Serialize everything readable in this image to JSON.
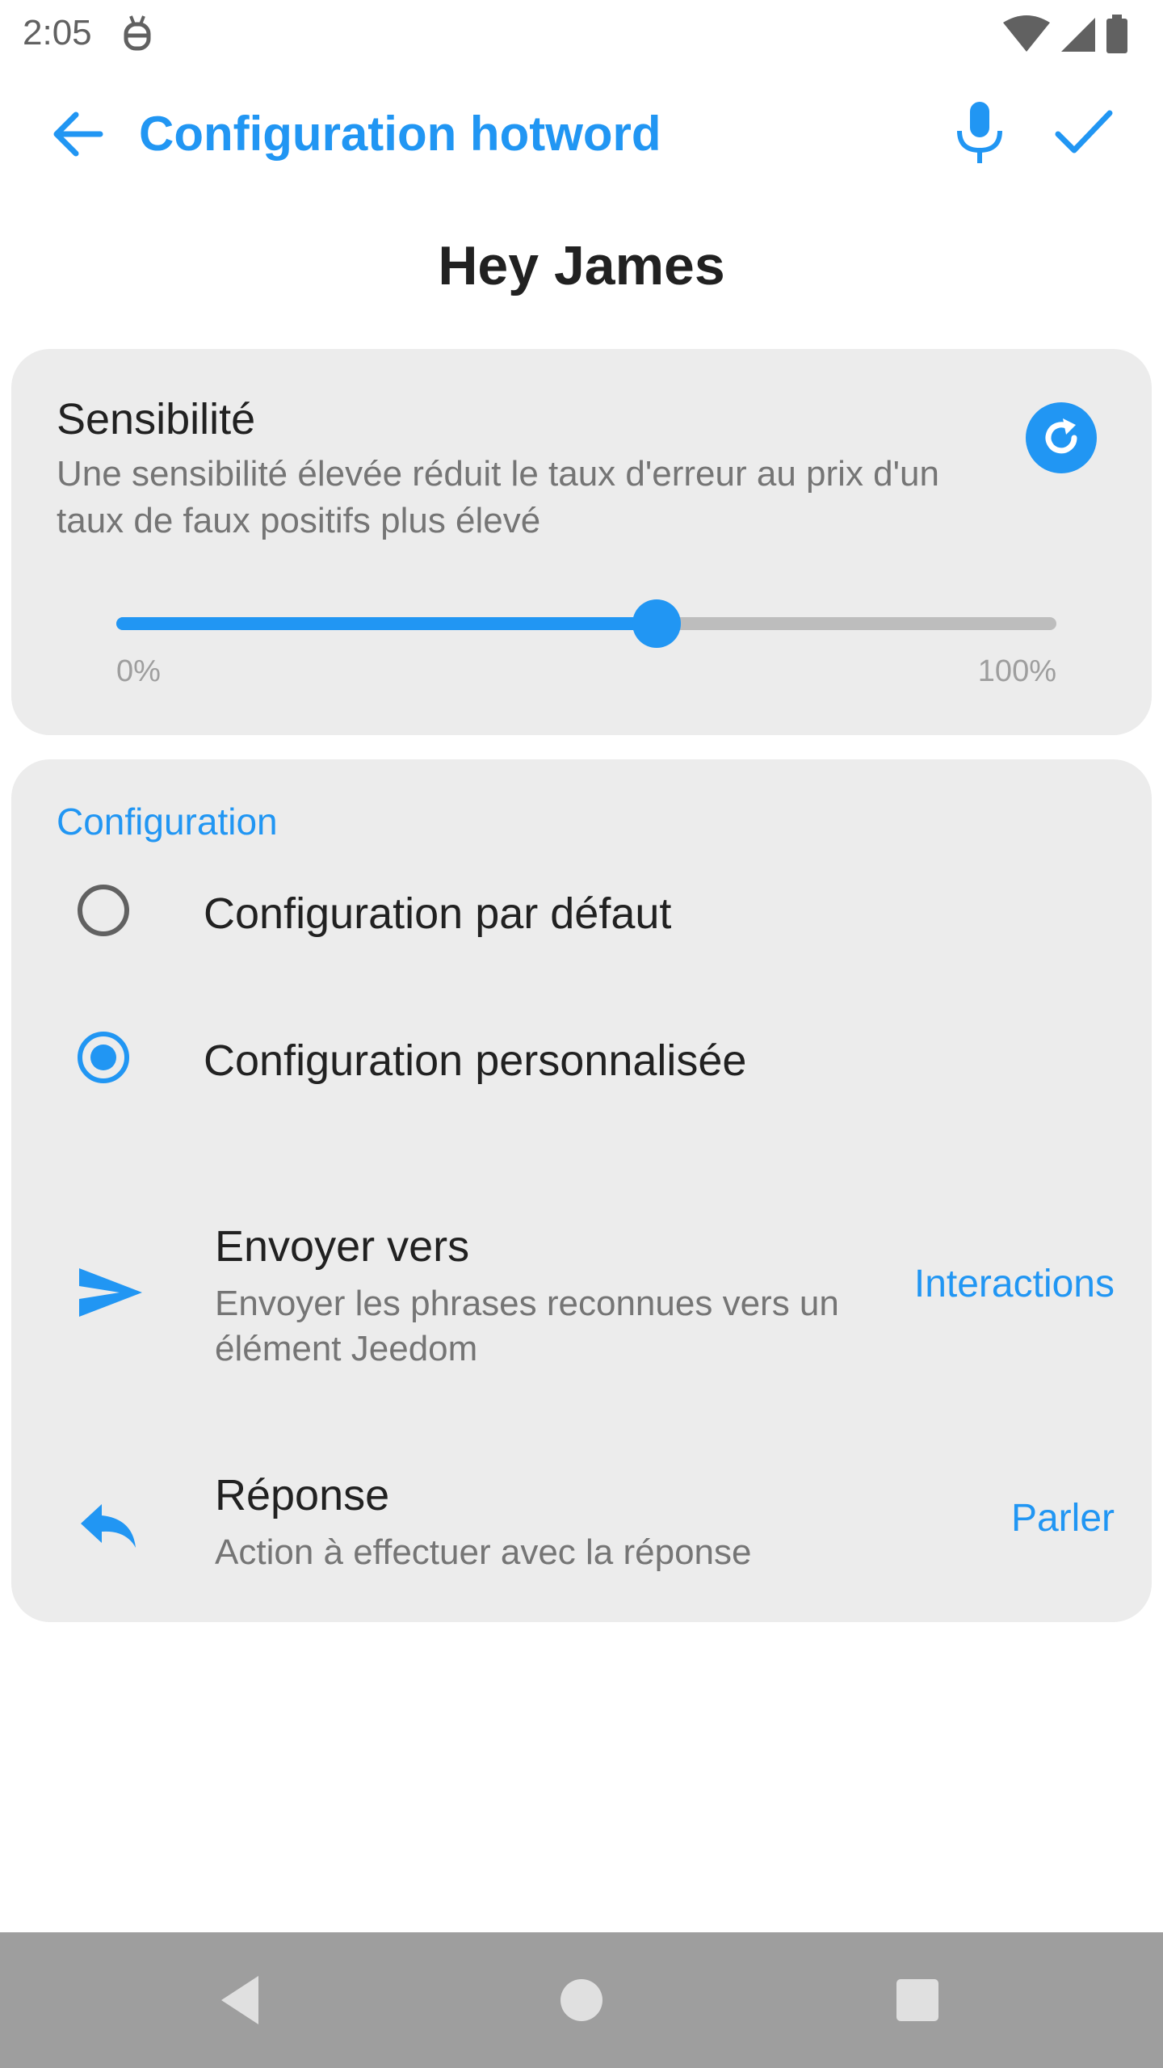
{
  "status_bar": {
    "time": "2:05",
    "icons": [
      "notification-icon",
      "wifi-icon",
      "signal-icon",
      "battery-icon"
    ]
  },
  "toolbar": {
    "title": "Configuration hotword",
    "icons": [
      "back-arrow-icon",
      "microphone-icon",
      "check-icon"
    ]
  },
  "hotword": {
    "name": "Hey James"
  },
  "sensitivity": {
    "title": "Sensibilité",
    "description": "Une sensibilité élevée réduit le taux d'erreur au prix d'un taux de faux positifs plus élevé",
    "refresh_icon": "refresh-icon",
    "slider": {
      "value_fraction": 0.575,
      "min_label": "0%",
      "max_label": "100%"
    }
  },
  "configuration": {
    "header": "Configuration",
    "options": [
      {
        "label": "Configuration par défaut",
        "selected": false
      },
      {
        "label": "Configuration personnalisée",
        "selected": true
      }
    ],
    "send_to": {
      "icon": "send-icon",
      "title": "Envoyer vers",
      "description": "Envoyer les phrases reconnues vers un élément Jeedom",
      "value": "Interactions"
    },
    "response": {
      "icon": "reply-icon",
      "title": "Réponse",
      "description": "Action à effectuer avec la réponse",
      "value": "Parler"
    }
  },
  "colors": {
    "accent": "#2196f3",
    "card_background": "#ececec",
    "navbar": "#9e9e9e"
  },
  "navbar": {
    "icons": [
      "nav-back-icon",
      "nav-home-icon",
      "nav-recents-icon"
    ]
  }
}
